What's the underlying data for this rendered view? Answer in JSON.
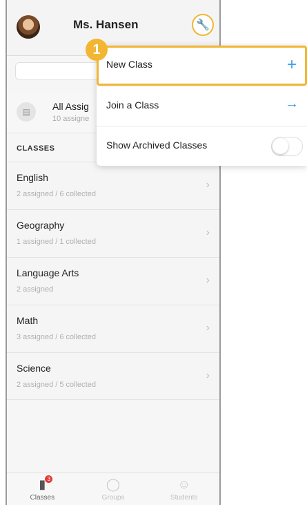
{
  "header": {
    "teacher_name": "Ms. Hansen"
  },
  "step_badge": "1",
  "search": {
    "glyph": "Q"
  },
  "all_assignments": {
    "title": "All Assig",
    "subtitle": "10 assigne"
  },
  "classes_label": "CLASSES",
  "classes": [
    {
      "name": "English",
      "status": "2 assigned / 6 collected"
    },
    {
      "name": "Geography",
      "status": "1 assigned / 1 collected"
    },
    {
      "name": "Language Arts",
      "status": "2 assigned"
    },
    {
      "name": "Math",
      "status": "3 assigned / 6 collected"
    },
    {
      "name": "Science",
      "status": "2 assigned / 5 collected"
    }
  ],
  "menu": {
    "new_class": "New Class",
    "join_class": "Join a Class",
    "show_archived": "Show Archived Classes"
  },
  "tabs": [
    {
      "label": "Classes",
      "badge": "3",
      "icon": "folder-icon"
    },
    {
      "label": "Groups",
      "icon": "groups-icon"
    },
    {
      "label": "Students",
      "icon": "students-icon"
    }
  ],
  "colors": {
    "highlight": "#f2b632",
    "accent": "#3ea0e8",
    "badge": "#e53935"
  }
}
